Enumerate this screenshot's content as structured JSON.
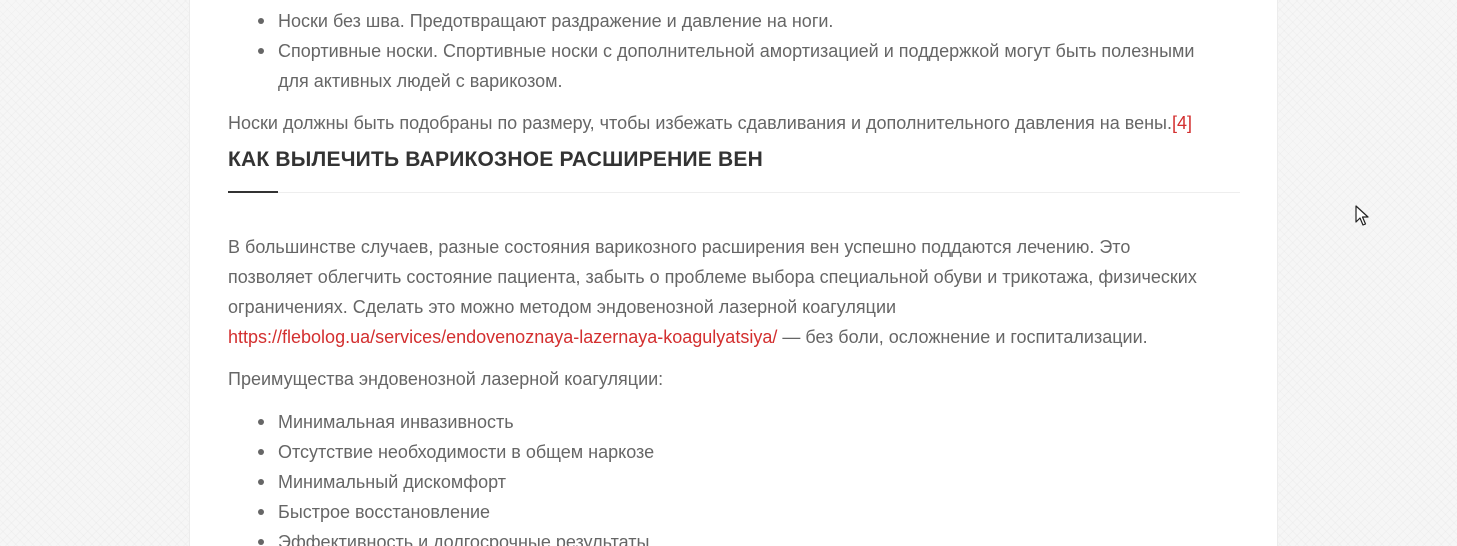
{
  "article": {
    "top_list": [
      "Носки без шва. Предотвращают раздражение и давление на ноги.",
      "Спортивные носки. Спортивные носки с дополнительной амортизацией и поддержкой могут быть полезными",
      "для активных людей с варикозом."
    ],
    "socks_paragraph": "Носки должны быть подобраны по размеру, чтобы избежать сдавливания и дополнительного давления на вены.",
    "socks_reference": "[4]",
    "section_heading": "КАК ВЫЛЕЧИТЬ ВАРИКОЗНОЕ РАСШИРЕНИЕ ВЕН",
    "treatment_lines": [
      "В большинстве случаев, разные состояния варикозного расширения вен успешно поддаются лечению. Это",
      "позволяет облегчить состояние пациента, забыть о проблеме выбора специальной обуви и трикотажа, физических",
      "ограничениях. Сделать это можно методом эндовенозной лазерной коагуляции"
    ],
    "treatment_link": "https://flebolog.ua/services/endovenoznaya-lazernaya-koagulyatsiya/",
    "treatment_tail": " — без боли, осложнение и госпитализации.",
    "advantages_intro": "Преимущества эндовенозной лазерной коагуляции:",
    "advantages": [
      "Минимальная инвазивность",
      "Отсутствие необходимости в общем наркозе",
      "Минимальный дискомфорт",
      "Быстрое восстановление",
      "Эффективность и долгосрочные результаты"
    ]
  },
  "colors": {
    "link": "#d32f2f",
    "body_text": "#666666",
    "heading": "#333333"
  }
}
